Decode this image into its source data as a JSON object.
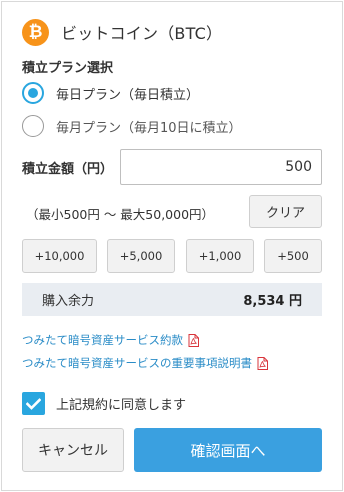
{
  "header": {
    "title": "ビットコイン（BTC）",
    "icon": "bitcoin-icon",
    "icon_color": "#f7931a",
    "icon_glyph": "₿"
  },
  "plan": {
    "label": "積立プラン選択",
    "options": [
      {
        "label": "毎日プラン（毎日積立）",
        "checked": true
      },
      {
        "label": "毎月プラン（毎月10日に積立）",
        "checked": false
      }
    ]
  },
  "amount": {
    "label": "積立金額（円）",
    "value": "500",
    "range": "（最小500円 〜 最大50,000円）",
    "clear_label": "クリア",
    "increments": [
      "+10,000",
      "+5,000",
      "+1,000",
      "+500"
    ]
  },
  "remaining": {
    "label": "購入余力",
    "value": "8,534 円"
  },
  "links": [
    {
      "label": "つみたて暗号資産サービス約款",
      "icon": "pdf-icon"
    },
    {
      "label": "つみたて暗号資産サービスの重要事項説明書",
      "icon": "pdf-icon"
    }
  ],
  "agree": {
    "label": "上記規約に同意します",
    "checked": true
  },
  "actions": {
    "cancel_label": "キャンセル",
    "confirm_label": "確認画面へ"
  },
  "colors": {
    "accent": "#29a6df",
    "primary_button": "#3aa0e0",
    "link": "#2a8cc7",
    "pdf": "#d9343b"
  }
}
